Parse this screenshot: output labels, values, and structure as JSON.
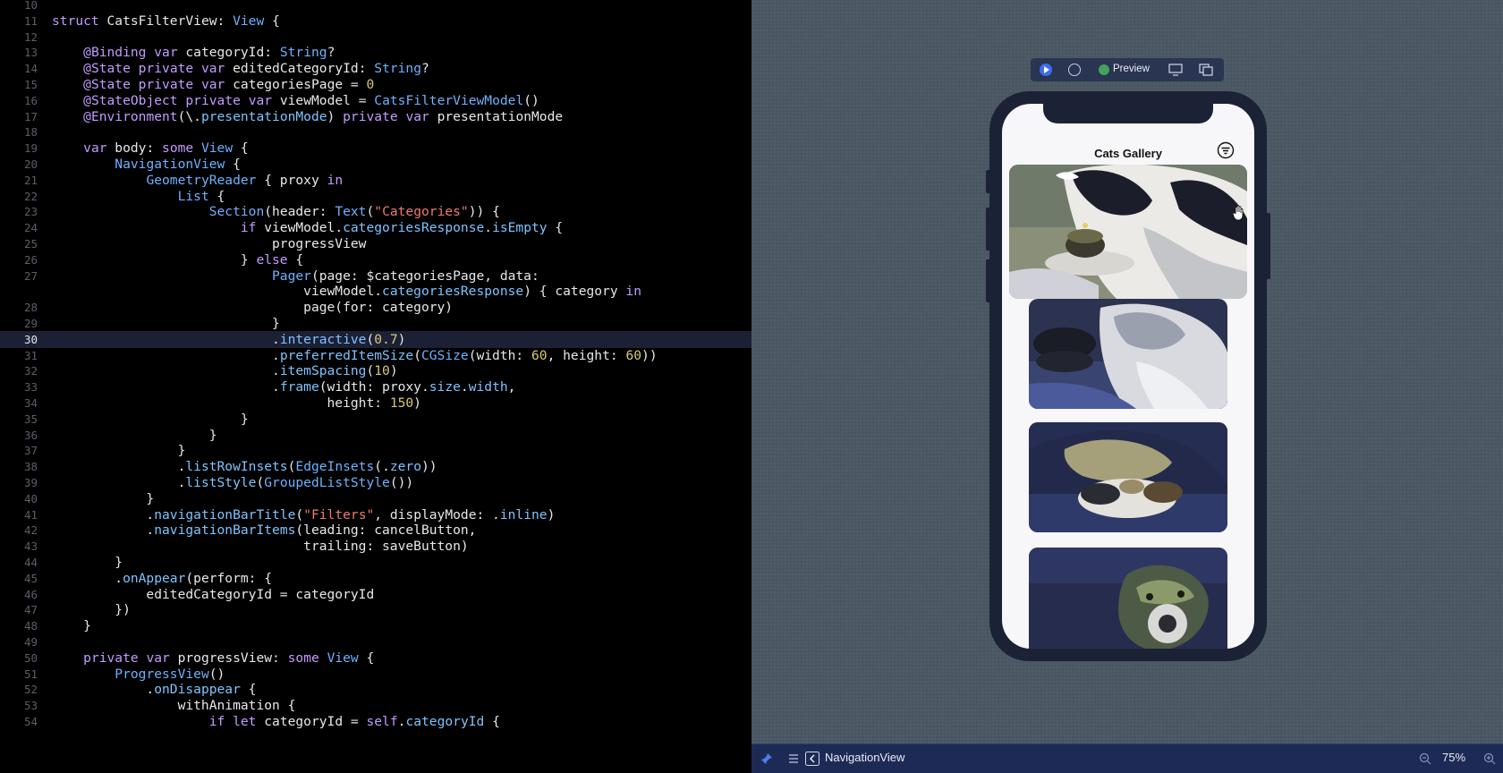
{
  "editor": {
    "current_line": "30",
    "lines": [
      {
        "n": "10",
        "t": ""
      },
      {
        "n": "11",
        "t": "struct CatsFilterView: View {"
      },
      {
        "n": "12",
        "t": ""
      },
      {
        "n": "13",
        "t": "    @Binding var categoryId: String?"
      },
      {
        "n": "14",
        "t": "    @State private var editedCategoryId: String?"
      },
      {
        "n": "15",
        "t": "    @State private var categoriesPage = 0"
      },
      {
        "n": "16",
        "t": "    @StateObject private var viewModel = CatsFilterViewModel()"
      },
      {
        "n": "17",
        "t": "    @Environment(\\.presentationMode) private var presentationMode"
      },
      {
        "n": "18",
        "t": ""
      },
      {
        "n": "19",
        "t": "    var body: some View {"
      },
      {
        "n": "20",
        "t": "        NavigationView {"
      },
      {
        "n": "21",
        "t": "            GeometryReader { proxy in"
      },
      {
        "n": "22",
        "t": "                List {"
      },
      {
        "n": "23",
        "t": "                    Section(header: Text(\"Categories\")) {"
      },
      {
        "n": "24",
        "t": "                        if viewModel.categoriesResponse.isEmpty {"
      },
      {
        "n": "25",
        "t": "                            progressView"
      },
      {
        "n": "26",
        "t": "                        } else {"
      },
      {
        "n": "27",
        "t": "                            Pager(page: $categoriesPage, data:"
      },
      {
        "n": "",
        "t": "                                viewModel.categoriesResponse) { category in"
      },
      {
        "n": "28",
        "t": "                                page(for: category)"
      },
      {
        "n": "29",
        "t": "                            }"
      },
      {
        "n": "30",
        "t": "                            .interactive(0.7)"
      },
      {
        "n": "31",
        "t": "                            .preferredItemSize(CGSize(width: 60, height: 60))"
      },
      {
        "n": "32",
        "t": "                            .itemSpacing(10)"
      },
      {
        "n": "33",
        "t": "                            .frame(width: proxy.size.width,"
      },
      {
        "n": "34",
        "t": "                                   height: 150)"
      },
      {
        "n": "35",
        "t": "                        }"
      },
      {
        "n": "36",
        "t": "                    }"
      },
      {
        "n": "37",
        "t": "                }"
      },
      {
        "n": "38",
        "t": "                .listRowInsets(EdgeInsets(.zero))"
      },
      {
        "n": "39",
        "t": "                .listStyle(GroupedListStyle())"
      },
      {
        "n": "40",
        "t": "            }"
      },
      {
        "n": "41",
        "t": "            .navigationBarTitle(\"Filters\", displayMode: .inline)"
      },
      {
        "n": "42",
        "t": "            .navigationBarItems(leading: cancelButton,"
      },
      {
        "n": "43",
        "t": "                                trailing: saveButton)"
      },
      {
        "n": "44",
        "t": "        }"
      },
      {
        "n": "45",
        "t": "        .onAppear(perform: {"
      },
      {
        "n": "46",
        "t": "            editedCategoryId = categoryId"
      },
      {
        "n": "47",
        "t": "        })"
      },
      {
        "n": "48",
        "t": "    }"
      },
      {
        "n": "49",
        "t": ""
      },
      {
        "n": "50",
        "t": "    private var progressView: some View {"
      },
      {
        "n": "51",
        "t": "        ProgressView()"
      },
      {
        "n": "52",
        "t": "            .onDisappear {"
      },
      {
        "n": "53",
        "t": "                withAnimation {"
      },
      {
        "n": "54",
        "t": "                    if let categoryId = self.categoryId {"
      }
    ]
  },
  "preview_toolbar": {
    "preview_label": "Preview",
    "icons": [
      "live-preview-icon",
      "inspect-icon",
      "preview-status-icon",
      "device-icon",
      "duplicate-icon"
    ]
  },
  "app": {
    "nav_title": "Cats Gallery",
    "filter_icon": "filter-icon"
  },
  "bottom_bar": {
    "breadcrumb": "NavigationView",
    "zoom": "75%"
  },
  "colors": {
    "canvas": "#4a5661",
    "editor_bg": "#000000",
    "keyword": "#c49bff",
    "type": "#6fb1ff",
    "string": "#f07b6f",
    "number": "#d9c978"
  }
}
